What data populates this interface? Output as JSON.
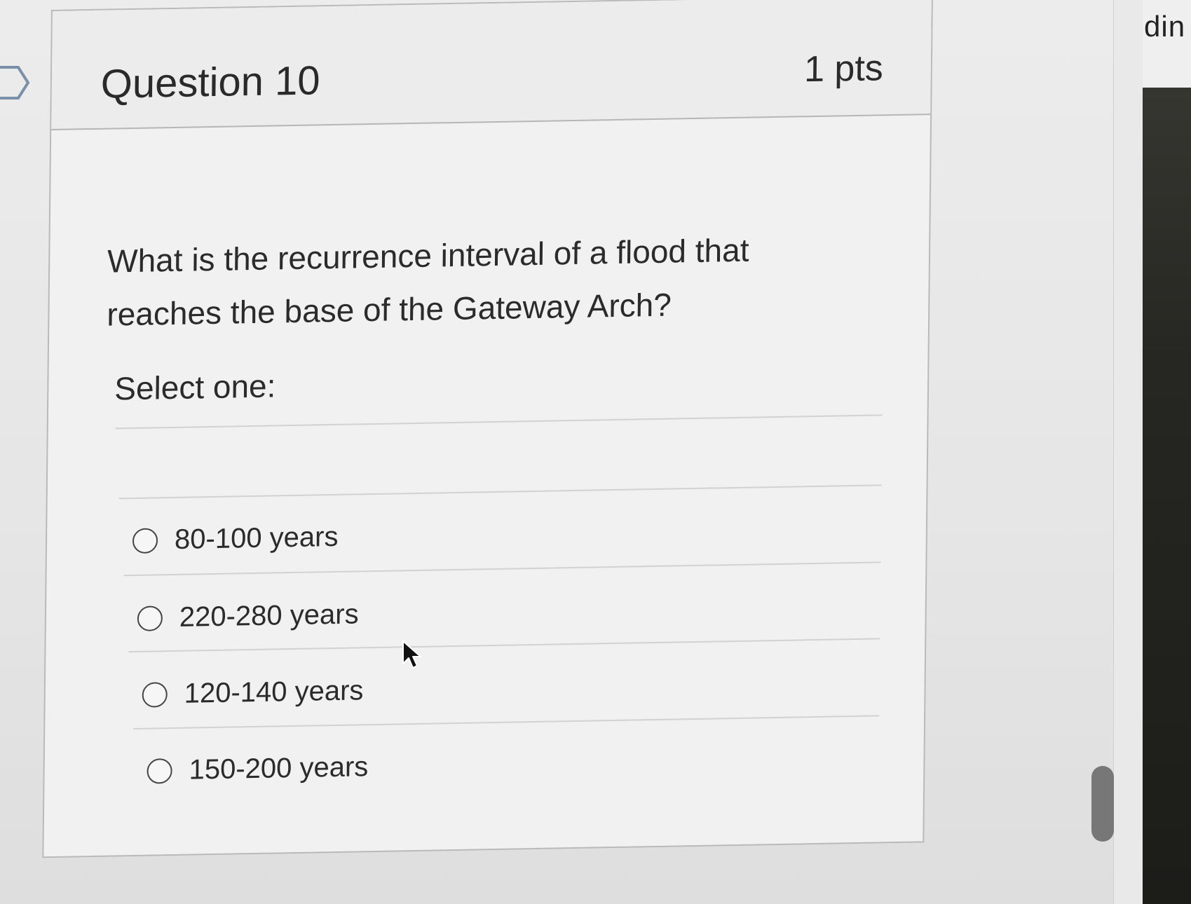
{
  "question": {
    "title": "Question 10",
    "points": "1 pts",
    "text": "What is the recurrence interval of a flood that reaches the base of the Gateway Arch?",
    "prompt": "Select one:",
    "answers": [
      {
        "label": "80-100 years",
        "selected": false
      },
      {
        "label": "220-280 years",
        "selected": false
      },
      {
        "label": "120-140 years",
        "selected": false
      },
      {
        "label": "150-200 years",
        "selected": false
      }
    ]
  },
  "right_edge": {
    "partial_text": "din"
  }
}
